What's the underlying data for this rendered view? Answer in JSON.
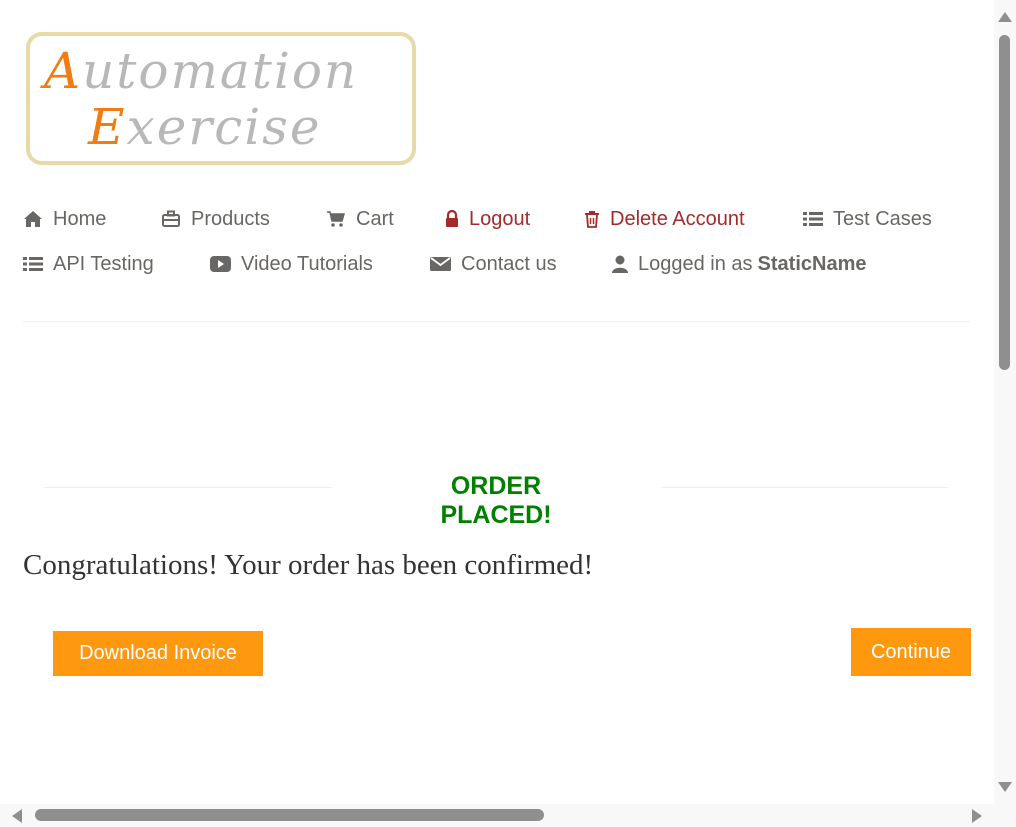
{
  "logo": {
    "line1_cap": "A",
    "line1_rest": "utomation",
    "line2_cap": "E",
    "line2_rest": "xercise"
  },
  "nav": {
    "home": "Home",
    "products": "Products",
    "cart": "Cart",
    "logout": "Logout",
    "delete_account": "Delete Account",
    "test_cases": "Test Cases",
    "api_testing": "API Testing",
    "video_tutorials": "Video Tutorials",
    "contact_us": "Contact us",
    "logged_in_prefix": "Logged in as",
    "username": "StaticName"
  },
  "order": {
    "title": "ORDER PLACED!",
    "message": "Congratulations! Your order has been confirmed!",
    "download_invoice": "Download Invoice",
    "continue": "Continue"
  },
  "icons": {
    "home": "home-icon",
    "products": "briefcase-icon",
    "cart": "cart-icon",
    "logout": "lock-icon",
    "delete": "trash-icon",
    "test_cases": "list-icon",
    "api_testing": "list-icon",
    "video": "youtube-play-icon",
    "contact": "envelope-icon",
    "user": "user-icon"
  },
  "colors": {
    "accent": "#fe980f",
    "success": "#008000",
    "danger": "#a52a2a",
    "text": "#696763"
  }
}
